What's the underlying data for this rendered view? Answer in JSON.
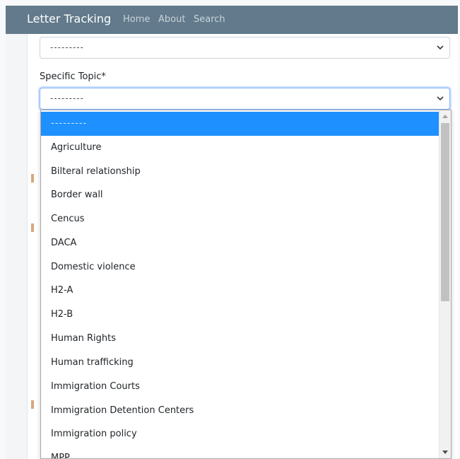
{
  "navbar": {
    "brand": "Letter Tracking",
    "links": [
      "Home",
      "About",
      "Search"
    ]
  },
  "form": {
    "top_select_value": "---------",
    "specific_topic_label": "Specific Topic*",
    "specific_topic_value": "---------"
  },
  "dropdown": {
    "options": [
      "---------",
      "Agriculture",
      "Bilteral relationship",
      "Border wall",
      "Cencus",
      "DACA",
      "Domestic violence",
      "H2-A",
      "H2-B",
      "Human Rights",
      "Human trafficking",
      "Immigration Courts",
      "Immigration Detention Centers",
      "Immigration policy",
      "MPP"
    ],
    "selected_index": 0
  },
  "colors": {
    "navbar": "#627a8b",
    "selected_option": "#1e90ff",
    "focus_border": "#86b7fe"
  }
}
